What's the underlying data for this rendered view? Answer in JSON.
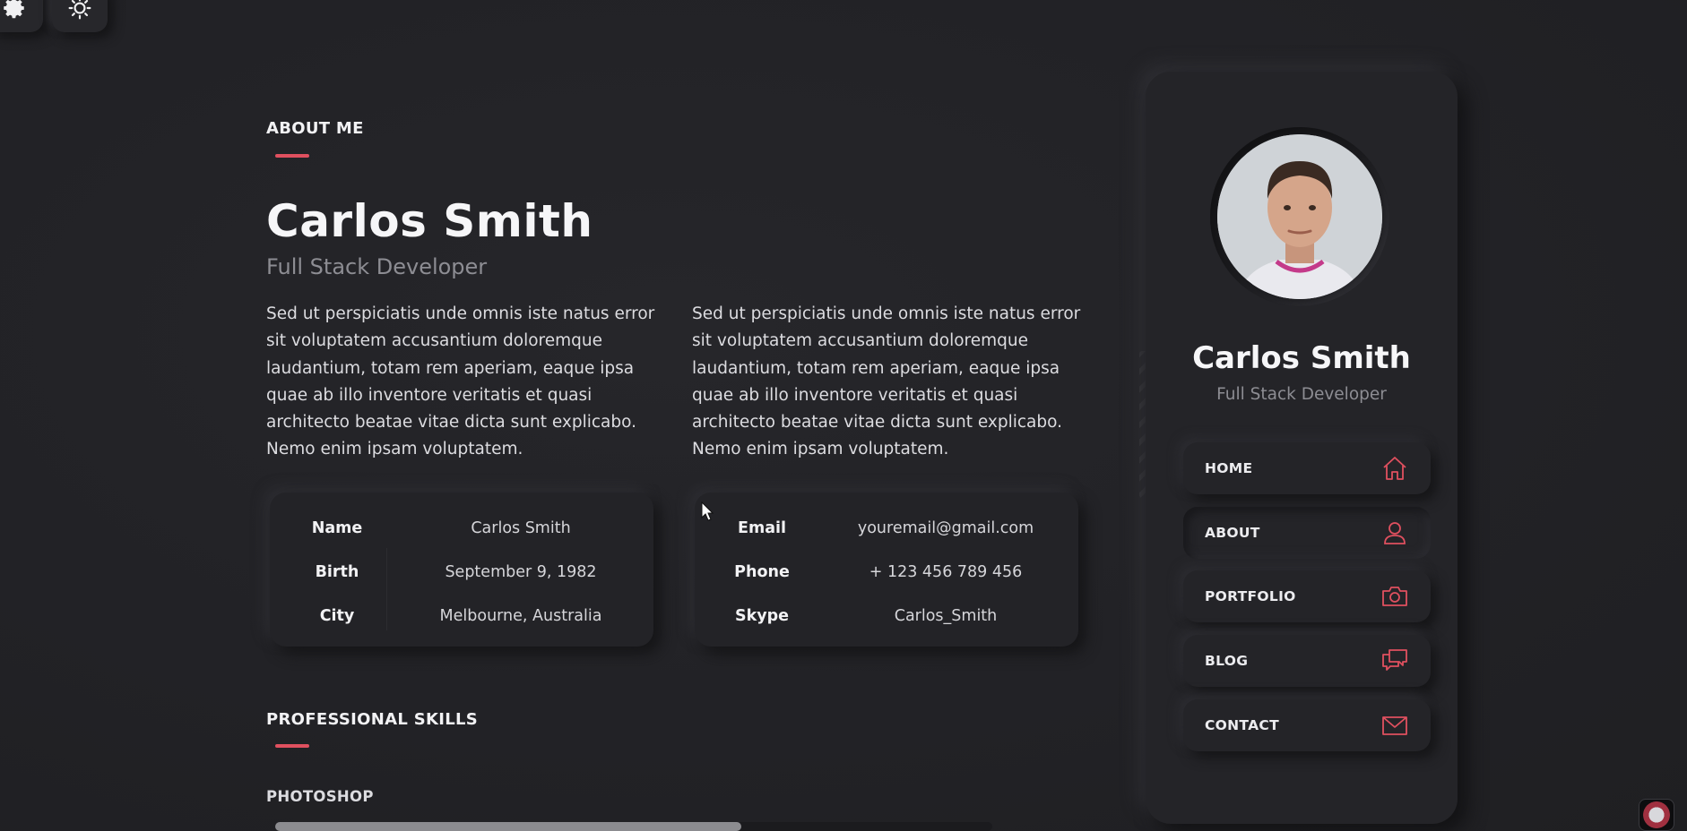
{
  "toolbar": {
    "settings_icon": "gear-icon",
    "theme_icon": "sun-icon"
  },
  "about": {
    "section_title": "ABOUT ME",
    "first_name": "Carlos",
    "last_name": "Smith",
    "role": "Full Stack Developer",
    "paragraph_left": "Sed ut perspiciatis unde omnis iste natus error sit voluptatem accusantium doloremque laudantium, totam rem aperiam, eaque ipsa quae ab illo inventore veritatis et quasi architecto beatae vitae dicta sunt explicabo. Nemo enim ipsam voluptatem.",
    "paragraph_right": "Sed ut perspiciatis unde omnis iste natus error sit voluptatem accusantium doloremque laudantium, totam rem aperiam, eaque ipsa quae ab illo inventore veritatis et quasi architecto beatae vitae dicta sunt explicabo. Nemo enim ipsam voluptatem."
  },
  "info_left": [
    {
      "key": "Name",
      "value": "Carlos Smith"
    },
    {
      "key": "Birth",
      "value": "September 9, 1982"
    },
    {
      "key": "City",
      "value": "Melbourne, Australia"
    }
  ],
  "info_right": [
    {
      "key": "Email",
      "value": "youremail@gmail.com"
    },
    {
      "key": "Phone",
      "value": "+ 123 456 789 456"
    },
    {
      "key": "Skype",
      "value": "Carlos_Smith"
    }
  ],
  "skills": {
    "section_title": "PROFESSIONAL SKILLS",
    "items": [
      {
        "label": "PHOTOSHOP",
        "level": 0.65
      }
    ]
  },
  "sidebar": {
    "first_name": "Carlos",
    "last_name": "Smith",
    "role": "Full Stack Developer",
    "nav": [
      {
        "label": "HOME",
        "icon": "home-icon",
        "active": false
      },
      {
        "label": "ABOUT",
        "icon": "user-icon",
        "active": true
      },
      {
        "label": "PORTFOLIO",
        "icon": "camera-icon",
        "active": false
      },
      {
        "label": "BLOG",
        "icon": "chat-icon",
        "active": false
      },
      {
        "label": "CONTACT",
        "icon": "mail-icon",
        "active": false
      }
    ]
  },
  "colors": {
    "accent": "#e0505f",
    "background": "#222226",
    "text": "#f2f2f4",
    "muted": "#8d8d93"
  }
}
